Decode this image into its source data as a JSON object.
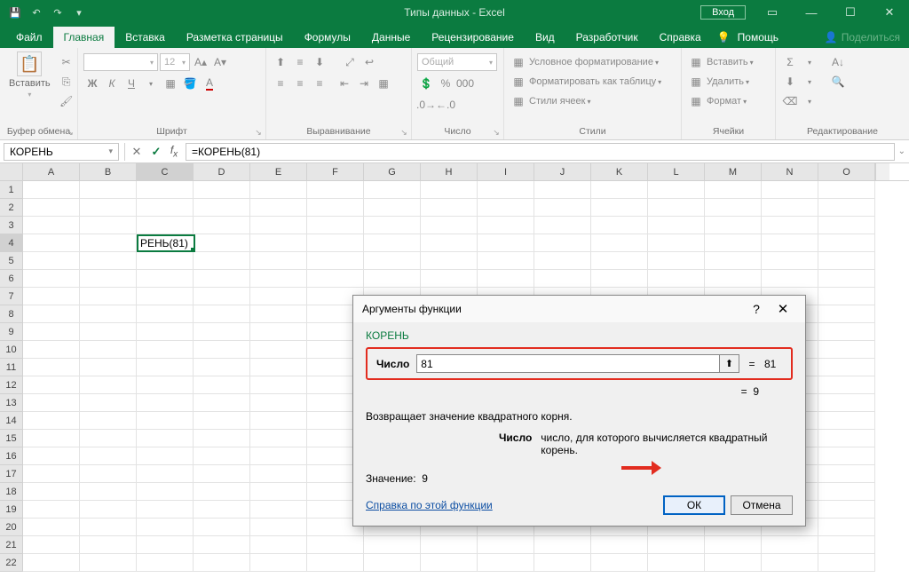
{
  "titlebar": {
    "title": "Типы данных  -  Excel",
    "login": "Вход"
  },
  "tabs": {
    "file": "Файл",
    "home": "Главная",
    "insert": "Вставка",
    "layout": "Разметка страницы",
    "formulas": "Формулы",
    "data": "Данные",
    "review": "Рецензирование",
    "view": "Вид",
    "developer": "Разработчик",
    "help": "Справка",
    "tellme": "Помощь",
    "share": "Поделиться"
  },
  "ribbon": {
    "clipboard": {
      "paste": "Вставить",
      "group": "Буфер обмена"
    },
    "font": {
      "size": "12",
      "group": "Шрифт"
    },
    "align": {
      "group": "Выравнивание"
    },
    "number": {
      "format": "Общий",
      "group": "Число"
    },
    "styles": {
      "cond": "Условное форматирование",
      "table": "Форматировать как таблицу",
      "cell": "Стили ячеек",
      "group": "Стили"
    },
    "cells": {
      "insert": "Вставить",
      "delete": "Удалить",
      "format": "Формат",
      "group": "Ячейки"
    },
    "editing": {
      "group": "Редактирование"
    }
  },
  "formulabar": {
    "namebox": "КОРЕНЬ",
    "formula": "=КОРЕНЬ(81)"
  },
  "columns": [
    "A",
    "B",
    "C",
    "D",
    "E",
    "F",
    "G",
    "H",
    "I",
    "J",
    "K",
    "L",
    "M",
    "N",
    "O"
  ],
  "active_cell": {
    "ref": "C4",
    "display": "РЕНЬ(81)"
  },
  "dialog": {
    "title": "Аргументы функции",
    "function": "КОРЕНЬ",
    "arg_label": "Число",
    "arg_value": "81",
    "arg_eval": "81",
    "result_eval": "9",
    "description": "Возвращает значение квадратного корня.",
    "arg_name": "Число",
    "arg_desc": "число, для которого вычисляется квадратный корень.",
    "value_label": "Значение:",
    "value": "9",
    "help_link": "Справка по этой функции",
    "ok": "ОК",
    "cancel": "Отмена"
  }
}
